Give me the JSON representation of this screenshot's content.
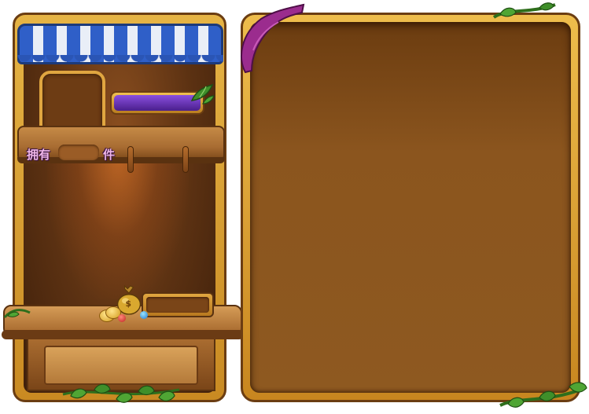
{
  "shop": {
    "owned_label": "拥有",
    "unit_label": "件"
  },
  "icons": {
    "money_bag": "money-bag-icon",
    "coins": "coin-icon",
    "gems": "gem-icon",
    "vines": "vine-decoration",
    "ribbon": "ribbon-decoration"
  },
  "colors": {
    "awning_blue": "#2f5fc8",
    "name_bar_purple": "#6a36b8",
    "label_pink": "#f0b6e8",
    "panel_brown": "#8b551e",
    "frame_gold": "#e6b445"
  }
}
